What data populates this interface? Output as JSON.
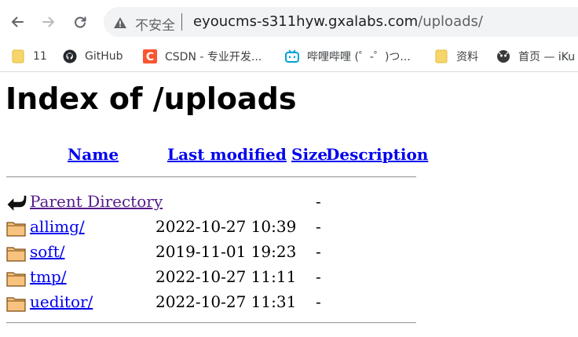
{
  "browser": {
    "security_label": "不安全",
    "url_host": "eyoucms-s311hyw.gxalabs.com",
    "url_path": "/uploads/",
    "bookmarks": [
      {
        "label": "11",
        "icon": "folder-icon"
      },
      {
        "label": "GitHub",
        "icon": "github-icon"
      },
      {
        "label": "CSDN - 专业开发...",
        "icon": "csdn-icon"
      },
      {
        "label": "哔哩哔哩 (゜-゜)つ...",
        "icon": "bilibili-icon"
      },
      {
        "label": "资料",
        "icon": "folder-icon"
      },
      {
        "label": "首页 — iKu",
        "icon": "iku-icon"
      }
    ]
  },
  "listing": {
    "title": "Index of /uploads",
    "columns": [
      "Name",
      "Last modified",
      "Size",
      "Description"
    ],
    "parent": {
      "label": "Parent Directory",
      "size": "-"
    },
    "rows": [
      {
        "name": "allimg/",
        "modified": "2022-10-27 10:39",
        "size": "-"
      },
      {
        "name": "soft/",
        "modified": "2019-11-01 19:23",
        "size": "-"
      },
      {
        "name": "tmp/",
        "modified": "2022-10-27 11:11",
        "size": "-"
      },
      {
        "name": "ueditor/",
        "modified": "2022-10-27 11:31",
        "size": "-"
      }
    ]
  },
  "colors": {
    "link": "#0000ee",
    "visited": "#551a8b",
    "chrome_bg": "#f1f3f4"
  }
}
